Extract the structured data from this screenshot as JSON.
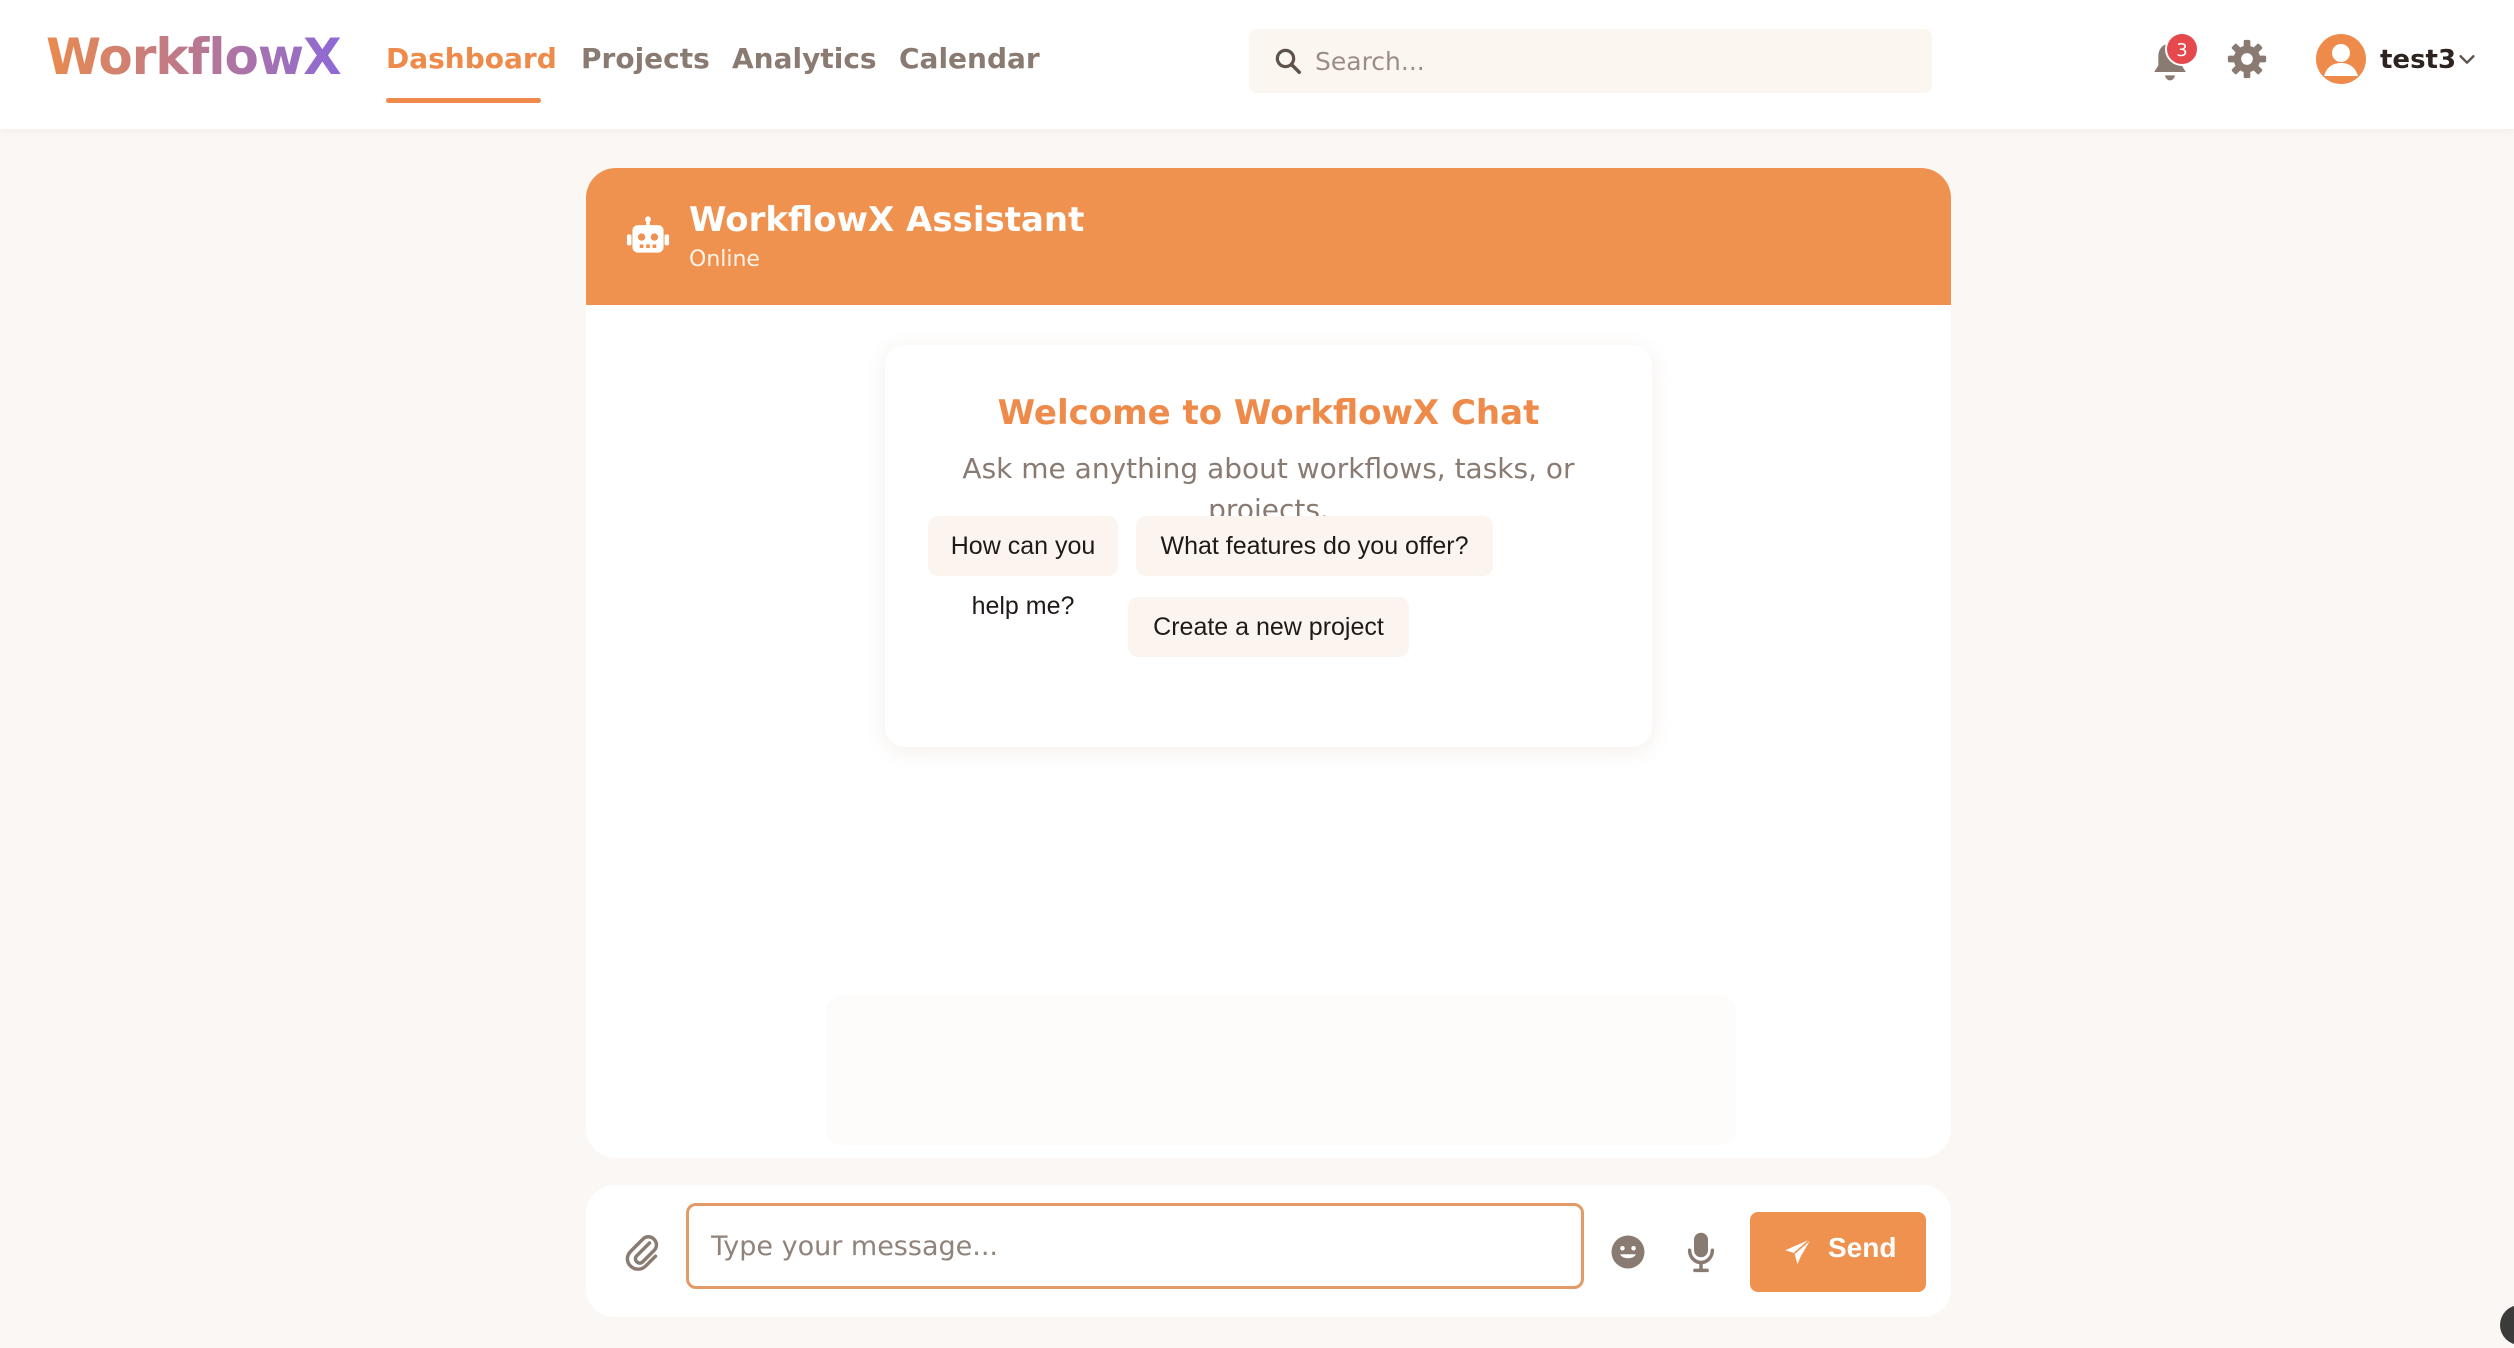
{
  "brand": {
    "logo_text": "WorkflowX"
  },
  "nav": {
    "items": [
      {
        "label": "Dashboard",
        "active": true
      },
      {
        "label": "Projects",
        "active": false
      },
      {
        "label": "Analytics",
        "active": false
      },
      {
        "label": "Calendar",
        "active": false
      }
    ]
  },
  "search": {
    "placeholder": "Search...",
    "value": "",
    "icon": "search-icon"
  },
  "header_actions": {
    "notifications": {
      "icon": "bell-icon",
      "count": "3"
    },
    "settings": {
      "icon": "gear-icon"
    },
    "user": {
      "name": "test3",
      "icon": "user-avatar-icon"
    }
  },
  "chat": {
    "title": "WorkflowX Assistant",
    "status": "Online",
    "icon": "robot-icon",
    "welcome": {
      "title": "Welcome to WorkflowX Chat",
      "text": "Ask me anything about workflows, tasks, or projects.",
      "suggestions": [
        "How can you help me?",
        "What features do you offer?",
        "Create a new project"
      ]
    }
  },
  "composer": {
    "placeholder": "Type your message...",
    "value": "",
    "send_label": "Send",
    "icons": [
      "paperclip-icon",
      "emoji-icon",
      "microphone-icon",
      "send-icon"
    ]
  },
  "colors": {
    "accent": "#f0924f",
    "page_bg": "#fbf7f4",
    "muted_text": "#8a7b72",
    "badge": "#e5484d"
  }
}
